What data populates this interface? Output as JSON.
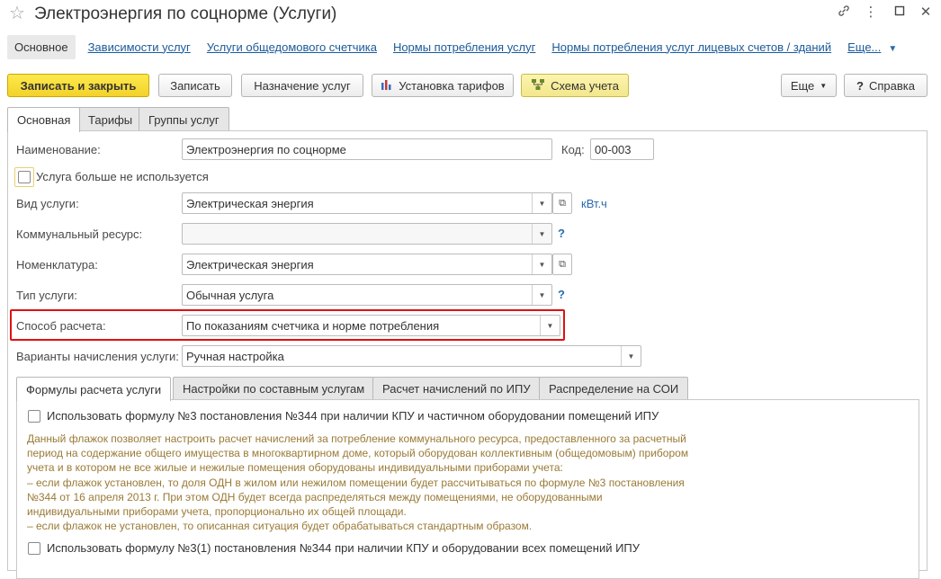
{
  "window": {
    "title": "Электроэнергия по соцнорме (Услуги)",
    "icons": {
      "favorite": "star-outline-icon",
      "link": "link-icon",
      "menu": "more-vertical-icon",
      "maximize": "maximize-icon",
      "close": "close-icon"
    }
  },
  "nav": {
    "current": "Основное",
    "links": [
      "Зависимости услуг",
      "Услуги общедомового счетчика",
      "Нормы потребления услуг",
      "Нормы потребления услуг лицевых счетов / зданий"
    ],
    "more": "Еще..."
  },
  "toolbar": {
    "save_close": "Записать и закрыть",
    "save": "Записать",
    "assign": "Назначение услуг",
    "tariffs": "Установка тарифов",
    "scheme": "Схема учета",
    "more": "Еще",
    "help": "Справка"
  },
  "tabs": [
    "Основная",
    "Тарифы",
    "Группы услуг"
  ],
  "form": {
    "name_label": "Наименование:",
    "name_value": "Электроэнергия по соцнорме",
    "code_label": "Код:",
    "code_value": "00-003",
    "unused_label": "Услуга больше не используется",
    "unused_checked": false,
    "service_kind_label": "Вид услуги:",
    "service_kind_value": "Электрическая энергия",
    "unit_link": "кВт.ч",
    "resource_label": "Коммунальный ресурс:",
    "resource_value": "",
    "nomenclature_label": "Номенклатура:",
    "nomenclature_value": "Электрическая энергия",
    "service_type_label": "Тип услуги:",
    "service_type_value": "Обычная услуга",
    "calc_method_label": "Способ расчета:",
    "calc_method_value": "По показаниям счетчика и норме потребления",
    "variants_label": "Варианты начисления услуги:",
    "variants_value": "Ручная настройка",
    "help_mark": "?"
  },
  "inner_tabs": [
    "Формулы расчета услуги",
    "Настройки по составным услугам",
    "Расчет начислений по ИПУ",
    "Распределение на СОИ"
  ],
  "formulas": {
    "option1_label": "Использовать формулу №3 постановления №344 при наличии КПУ и частичном оборудовании помещений ИПУ",
    "option1_checked": false,
    "description": "Данный флажок позволяет настроить расчет начислений за потребление коммунального ресурса, предоставленного за расчетный\nпериод на содержание общего имущества в многоквартирном доме, который оборудован коллективным (общедомовым) прибором\nучета и в котором не все жилые и нежилые помещения оборудованы индивидуальными приборами учета:\n– если флажок установлен, то доля ОДН в жилом или нежилом помещении будет рассчитываться по формуле №3 постановления\n№344 от 16 апреля 2013 г. При этом ОДН будет всегда распределяться между помещениями, не оборудованными\nиндивидуальными приборами учета, пропорционально их общей площади.\n– если флажок не установлен, то описанная ситуация будет обрабатываться стандартным образом.",
    "option2_label": "Использовать формулу №3(1) постановления №344 при наличии КПУ и оборудовании всех помещений ИПУ",
    "option2_checked": false
  },
  "colors": {
    "link": "#1a5a9a",
    "primary_button": "#f6d92f",
    "highlight_frame": "#e01010",
    "description_text": "#9a7a36"
  }
}
